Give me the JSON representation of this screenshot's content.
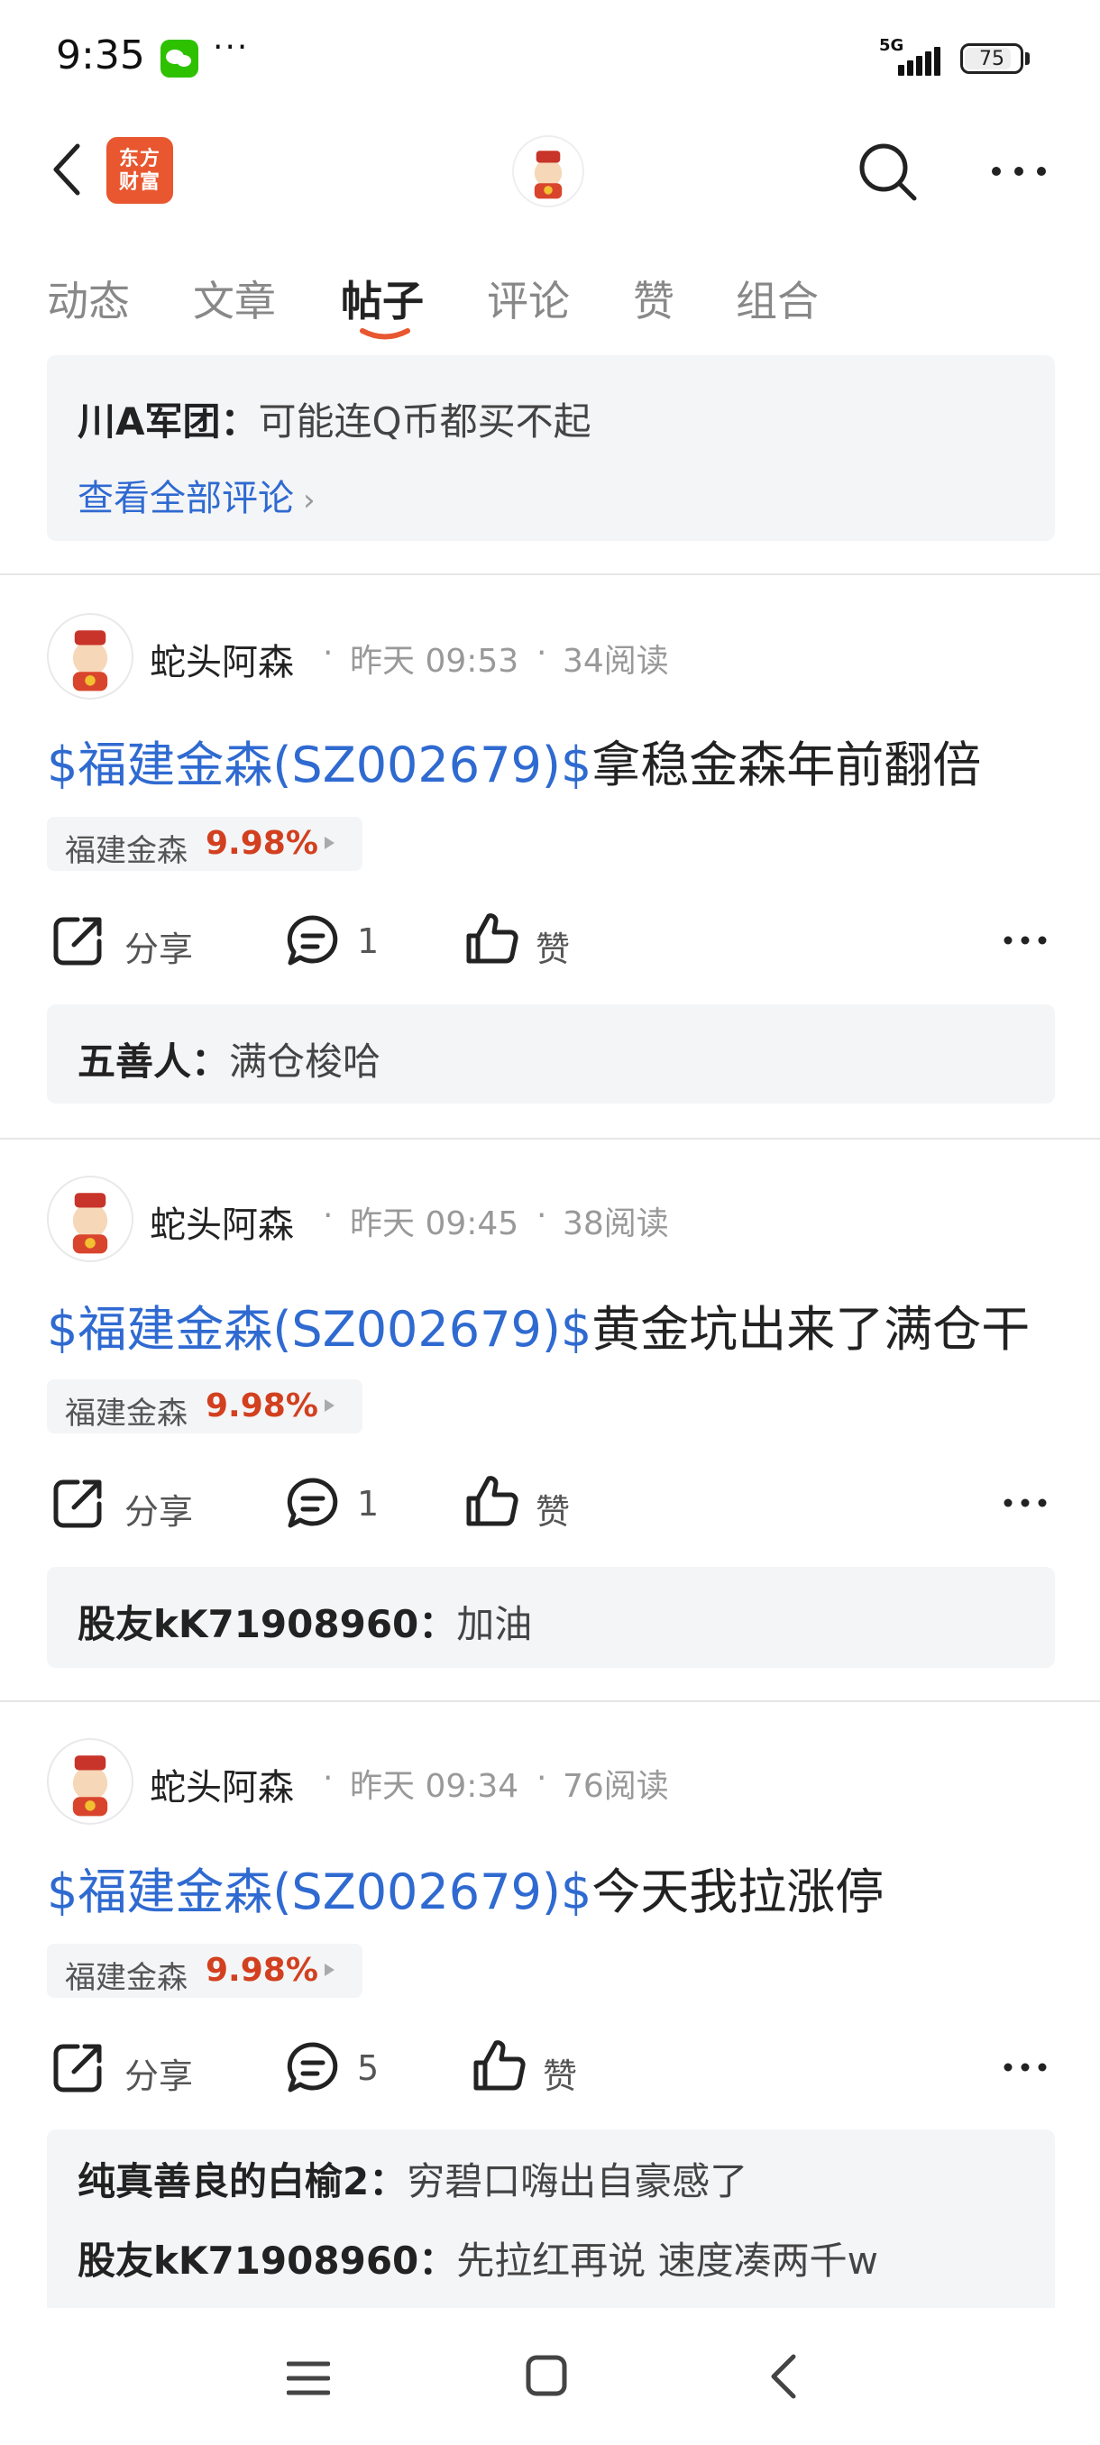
{
  "status_bar": {
    "time": "9:35",
    "more": "···",
    "network": "5G",
    "battery": "75"
  },
  "header": {
    "logo_text_1": "东方",
    "logo_text_2": "财富"
  },
  "tabs": [
    {
      "label": "动态"
    },
    {
      "label": "文章"
    },
    {
      "label": "帖子",
      "active": true
    },
    {
      "label": "评论"
    },
    {
      "label": "赞"
    },
    {
      "label": "组合"
    }
  ],
  "top_comment_card": {
    "user": "川A军团：",
    "text": "可能连Q币都买不起",
    "view_all": "查看全部评论"
  },
  "posts": [
    {
      "author": "蛇头阿森",
      "sep1": "·",
      "time": "昨天 09:53",
      "sep2": "·",
      "reads": "34阅读",
      "stock_link": "$福建金森(SZ002679)$",
      "title": "拿稳金森年前翻倍",
      "tag_name": "福建金森",
      "tag_pct": "9.98%",
      "share": "分享",
      "comment_count": "1",
      "like": "赞",
      "comments": [
        {
          "user": "五善人：",
          "text": "满仓梭哈"
        }
      ]
    },
    {
      "author": "蛇头阿森",
      "sep1": "·",
      "time": "昨天 09:45",
      "sep2": "·",
      "reads": "38阅读",
      "stock_link": "$福建金森(SZ002679)$",
      "title": "黄金坑出来了满仓干",
      "tag_name": "福建金森",
      "tag_pct": "9.98%",
      "share": "分享",
      "comment_count": "1",
      "like": "赞",
      "comments": [
        {
          "user": "股友kK71908960：",
          "text": "加油"
        }
      ]
    },
    {
      "author": "蛇头阿森",
      "sep1": "·",
      "time": "昨天 09:34",
      "sep2": "·",
      "reads": "76阅读",
      "stock_link": "$福建金森(SZ002679)$",
      "title": "今天我拉涨停",
      "tag_name": "福建金森",
      "tag_pct": "9.98%",
      "share": "分享",
      "comment_count": "5",
      "like": "赞",
      "comments": [
        {
          "user": "纯真善良的白榆2：",
          "text": "穷碧口嗨出自豪感了"
        },
        {
          "user": "股友kK71908960：",
          "text": "先拉红再说 速度凑两千w"
        }
      ]
    }
  ],
  "colors": {
    "link_blue": "#2f6ad1",
    "gain_red": "#d2401f",
    "tab_underline": "#e8572f",
    "logo": "#e8572f"
  }
}
